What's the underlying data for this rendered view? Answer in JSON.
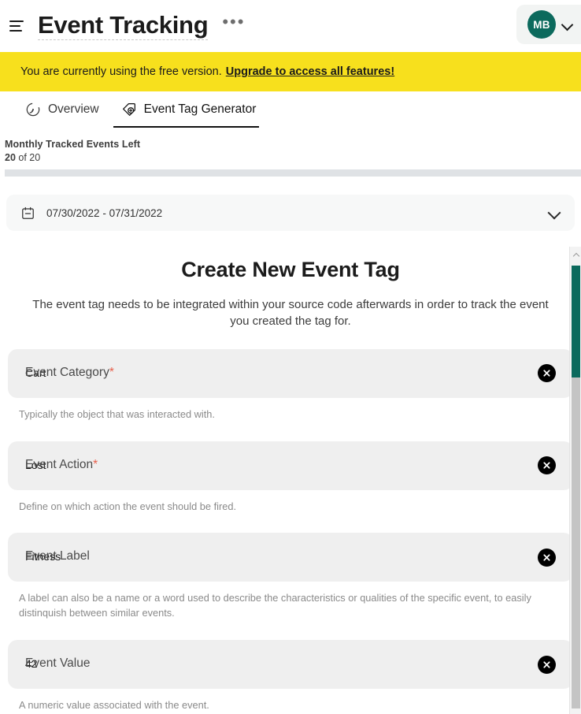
{
  "header": {
    "menu_icon": "hamburger-icon",
    "title": "Event Tracking",
    "more_dots": "•••",
    "avatar_initials": "MB",
    "avatar_color": "#0c6a5d",
    "chevron_icon": "chevron-down-icon"
  },
  "banner": {
    "text": "You are currently using the free version.",
    "link_text": "Upgrade to access all features!",
    "background_color": "#f7e01d"
  },
  "tabs": [
    {
      "label": "Overview",
      "icon": "radar-icon",
      "active": false
    },
    {
      "label": "Event Tag Generator",
      "icon": "tag-plus-icon",
      "active": true
    }
  ],
  "quota": {
    "label": "Monthly Tracked Events Left",
    "count_value": "20",
    "count_suffix": " of 20",
    "progress_percent": 100
  },
  "date_range": {
    "icon": "calendar-icon",
    "value": "07/30/2022 - 07/31/2022",
    "chevron_icon": "chevron-down-icon"
  },
  "form": {
    "title": "Create New Event Tag",
    "subtitle": "The event tag needs to be integrated within your source code afterwards in order to track the event you created the tag for.",
    "fields": [
      {
        "label": "Event Category",
        "required": true,
        "required_marker": "*",
        "value": "Cart",
        "help": "Typically the object that was interacted with.",
        "clear_icon": "clear-x-icon"
      },
      {
        "label": "Event Action",
        "required": true,
        "required_marker": "*",
        "value": "Lost",
        "help": "Define on which action the event should be fired.",
        "clear_icon": "clear-x-icon"
      },
      {
        "label": "Event Label",
        "required": false,
        "required_marker": "",
        "value": "Fitness",
        "help": "A label can also be a name or a word used to describe the characteristics or qualities of the specific event, to easily distinquish between similar events.",
        "clear_icon": "clear-x-icon"
      },
      {
        "label": "Event Value",
        "required": false,
        "required_marker": "",
        "value": "42",
        "help": "A numeric value associated with the event.",
        "clear_icon": "clear-x-icon"
      }
    ]
  },
  "scrollbar": {
    "up_arrow_icon": "scroll-up-arrow-icon",
    "thumb_color": "#0c6a5d"
  }
}
